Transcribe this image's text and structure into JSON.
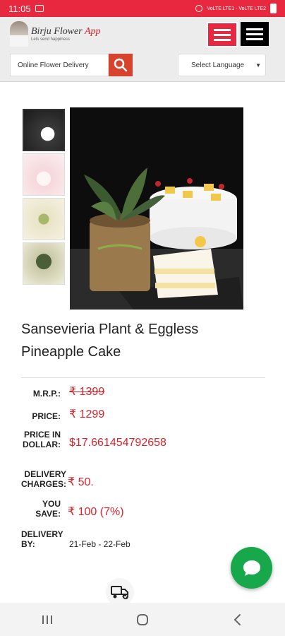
{
  "status_bar": {
    "time": "11:05",
    "network": "VoLTE LTE1 · VoLTE LTE2"
  },
  "header": {
    "logo_title_main": "Birju Flower",
    "logo_title_app": "App",
    "logo_subtitle": "Lets send happiness",
    "search_placeholder": "Online Flower Delivery",
    "language_label": "Select Language"
  },
  "product": {
    "title": "Sansevieria Plant & Eggless Pineapple Cake",
    "thumbnails": [
      "thumb-1",
      "thumb-2",
      "thumb-3",
      "thumb-4"
    ]
  },
  "pricing": {
    "mrp_label": "M.R.P.:",
    "mrp_value": "₹ 1399",
    "price_label": "PRICE:",
    "price_value": "₹ 1299",
    "dollar_label": "PRICE IN DOLLAR:",
    "dollar_value": "$17.661454792658",
    "delivery_charges_label": "DELIVERY CHARGES:",
    "delivery_charges_value": "₹ 50.",
    "you_save_label": "YOU SAVE:",
    "you_save_value": "₹ 100 (7%)",
    "delivery_by_label": "DELIVERY BY:",
    "delivery_by_value": "21-Feb - 22-Feb"
  },
  "colors": {
    "brand_red": "#e8283e",
    "price_red": "#d8232a",
    "chat_green": "#17a84b"
  }
}
